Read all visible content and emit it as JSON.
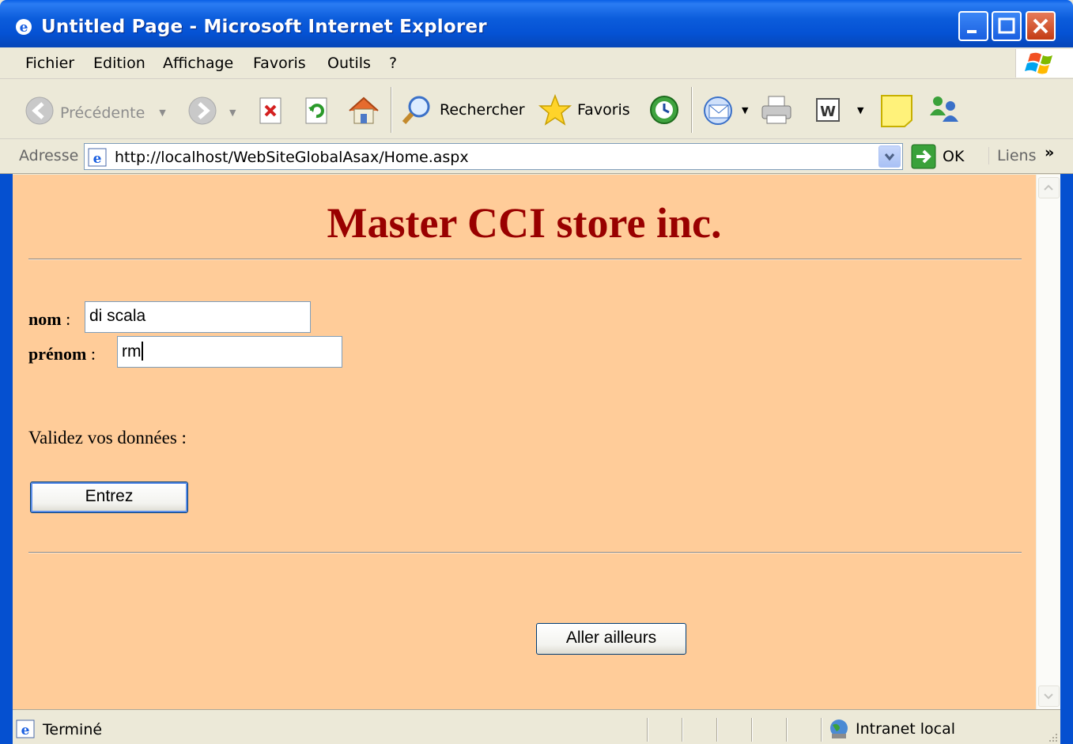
{
  "window": {
    "title": "Untitled Page - Microsoft Internet Explorer"
  },
  "menu": {
    "items": [
      {
        "label": "Fichier"
      },
      {
        "label": "Edition"
      },
      {
        "label": "Affichage"
      },
      {
        "label": "Favoris"
      },
      {
        "label": "Outils"
      },
      {
        "label": "?"
      }
    ]
  },
  "toolbar": {
    "back_label": "Précédente",
    "search_label": "Rechercher",
    "favorites_label": "Favoris"
  },
  "address": {
    "label": "Adresse",
    "url": "http://localhost/WebSiteGlobalAsax/Home.aspx",
    "go_label": "OK",
    "links_label": "Liens",
    "links_chevron": "»"
  },
  "page": {
    "heading": "Master CCI store inc.",
    "nom_label": "nom",
    "nom_value": "di scala",
    "prenom_label": "prénom",
    "prenom_value": "rm",
    "colon": " :",
    "validate_text": "Validez vos données :",
    "submit_button": "Entrez",
    "other_button": "Aller ailleurs"
  },
  "status": {
    "text": "Terminé",
    "zone": "Intranet local"
  }
}
